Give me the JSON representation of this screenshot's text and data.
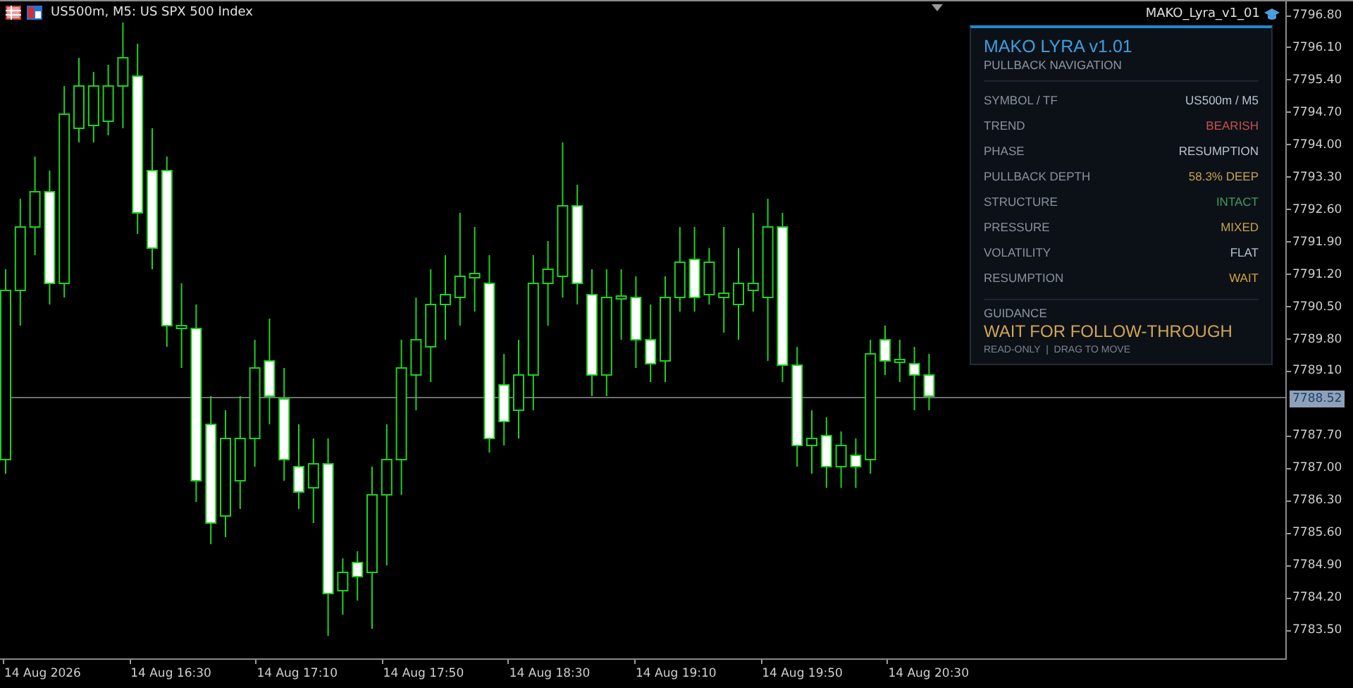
{
  "chart": {
    "title": "US500m, M5:  US SPX 500 Index",
    "indicator_label": "MAKO_Lyra_v1_01",
    "price_ticks_upper": [
      "7796.80",
      "7796.10",
      "7795.40",
      "7794.70",
      "7794.00",
      "7793.30",
      "7792.60",
      "7791.90",
      "7791.20",
      "7790.50",
      "7789.80",
      "7789.10"
    ],
    "price_ticks_lower": [
      "7787.70",
      "7787.00",
      "7786.30",
      "7785.60",
      "7784.90",
      "7784.20",
      "7783.50"
    ],
    "current_price": "7788.52",
    "time_ticks": [
      "14 Aug 2026",
      "14 Aug 16:30",
      "14 Aug 17:10",
      "14 Aug 17:50",
      "14 Aug 18:30",
      "14 Aug 19:10",
      "14 Aug 19:50",
      "14 Aug 20:30"
    ]
  },
  "panel": {
    "title": "MAKO LYRA v1.01",
    "subtitle": "PULLBACK NAVIGATION",
    "rows": [
      {
        "label": "SYMBOL / TF",
        "value": "US500m / M5",
        "color": "#b8c2ce"
      },
      {
        "label": "TREND",
        "value": "BEARISH",
        "color": "#c9504e"
      },
      {
        "label": "PHASE",
        "value": "RESUMPTION",
        "color": "#b8c2ce"
      },
      {
        "label": "PULLBACK DEPTH",
        "value": "58.3%  DEEP",
        "color": "#c6a24e"
      },
      {
        "label": "STRUCTURE",
        "value": "INTACT",
        "color": "#3f9a5e"
      },
      {
        "label": "PRESSURE",
        "value": "MIXED",
        "color": "#c6a24e"
      },
      {
        "label": "VOLATILITY",
        "value": "FLAT",
        "color": "#b8c2ce"
      },
      {
        "label": "RESUMPTION",
        "value": "WAIT",
        "color": "#d6a23a"
      }
    ],
    "guidance_label": "GUIDANCE",
    "guidance": "WAIT FOR FOLLOW-THROUGH",
    "footer": "READ-ONLY  |  DRAG TO MOVE"
  }
}
